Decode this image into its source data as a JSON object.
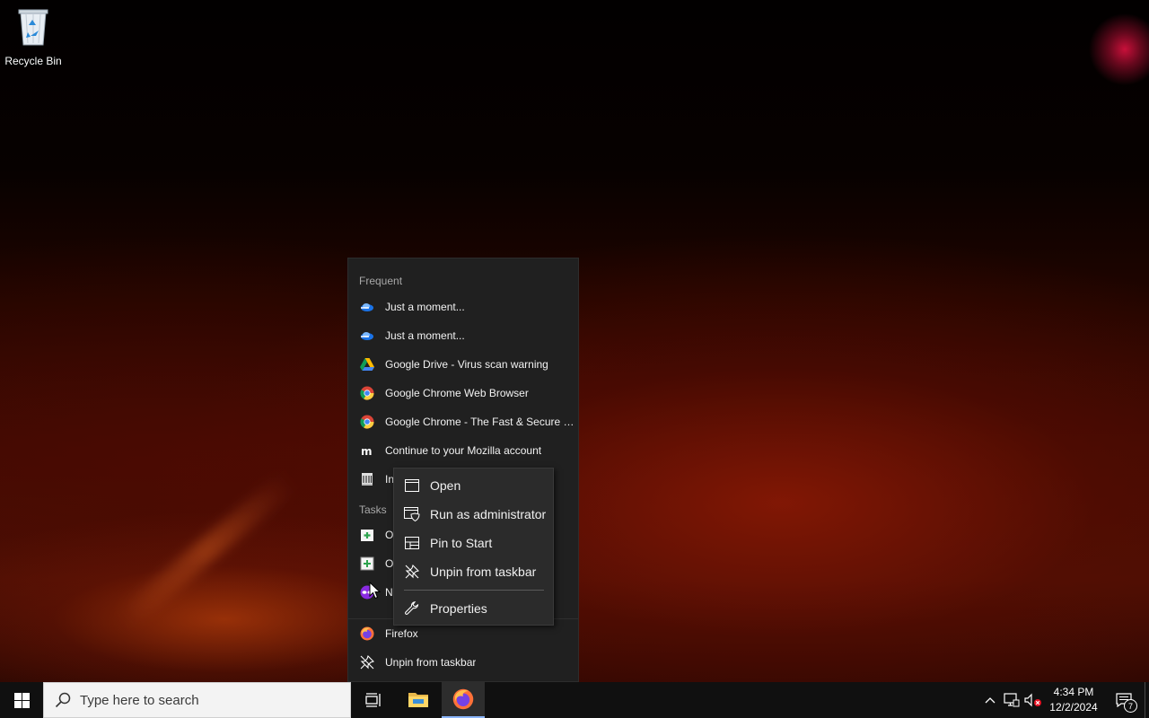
{
  "desktop": {
    "icons": [
      {
        "label": "Recycle Bin",
        "icon": "recycle-bin-icon"
      }
    ]
  },
  "jumplist": {
    "frequent_header": "Frequent",
    "frequent": [
      {
        "label": "Just a moment...",
        "icon": "cloud-icon"
      },
      {
        "label": "Just a moment...",
        "icon": "cloud-icon"
      },
      {
        "label": "Google Drive - Virus scan warning",
        "icon": "google-drive-icon"
      },
      {
        "label": "Google Chrome Web Browser",
        "icon": "chrome-icon"
      },
      {
        "label": "Google Chrome - The Fast & Secure W...",
        "icon": "chrome-icon"
      },
      {
        "label": "Continue to your Mozilla account",
        "icon": "mozilla-icon"
      },
      {
        "label": "In",
        "icon": "bank-icon"
      }
    ],
    "tasks_header": "Tasks",
    "tasks": [
      {
        "label": "O",
        "icon": "new-window-icon"
      },
      {
        "label": "O",
        "icon": "new-private-window-icon"
      },
      {
        "label": "N",
        "icon": "private-mask-icon"
      }
    ],
    "app": [
      {
        "label": "Firefox",
        "icon": "firefox-icon"
      },
      {
        "label": "Unpin from taskbar",
        "icon": "unpin-icon"
      }
    ]
  },
  "context_menu": {
    "items": [
      {
        "label": "Open",
        "icon": "window-icon"
      },
      {
        "label": "Run as administrator",
        "icon": "shield-window-icon"
      },
      {
        "label": "Pin to Start",
        "icon": "pin-start-icon"
      },
      {
        "label": "Unpin from taskbar",
        "icon": "unpin-icon"
      },
      {
        "label": "Properties",
        "icon": "wrench-icon"
      }
    ]
  },
  "taskbar": {
    "search_placeholder": "Type here to search",
    "pinned": [
      {
        "name": "Task View",
        "icon": "task-view-icon"
      },
      {
        "name": "File Explorer",
        "icon": "folder-icon"
      },
      {
        "name": "Firefox",
        "icon": "firefox-icon",
        "active": true
      }
    ],
    "tray": {
      "time": "4:34 PM",
      "date": "12/2/2024",
      "notification_count": "7"
    }
  },
  "colors": {
    "menu_bg": "#2b2b2b",
    "jumplist_bg": "#202020",
    "taskbar_bg": "#101010",
    "accent": "#8ab4f8"
  }
}
